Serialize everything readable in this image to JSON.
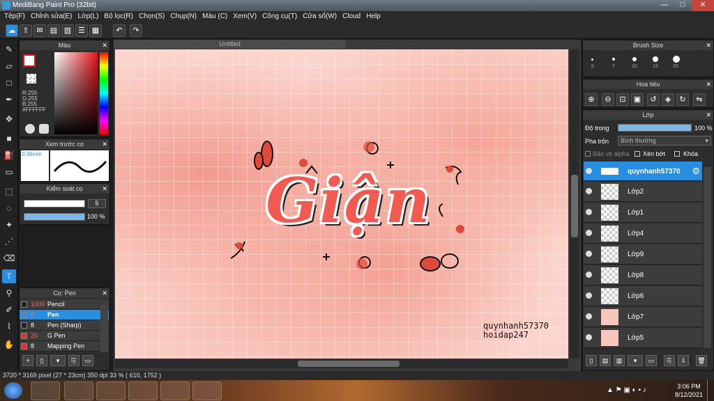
{
  "window": {
    "title": "MediBang Paint Pro (32bit)"
  },
  "menu": [
    "Tệp(F)",
    "Chỉnh sửa(E)",
    "Lớp(L)",
    "Bộ lọc(R)",
    "Chọn(S)",
    "Chụp(N)",
    "Màu (C)",
    "Xem(V)",
    "Công cụ(T)",
    "Cửa sổ(W)",
    "Cloud",
    "Help"
  ],
  "color_panel": {
    "title": "Màu",
    "r": "R:255",
    "g": "G:255",
    "b": "B:255",
    "hex": "#FFFFFF",
    "primary_color": "#e8141b"
  },
  "preview_panel": {
    "title": "Xem trước cọ",
    "size": "0.36mm"
  },
  "brush_control": {
    "title": "Kiểm soát cọ",
    "size_value": "5",
    "opacity_value": "100 %"
  },
  "brush_list": {
    "title": "Cọ: Pen",
    "items": [
      {
        "size": "1000",
        "name": "Pencil",
        "color": "#222222",
        "selected": false
      },
      {
        "size": "5",
        "name": "Pen",
        "color": "#2a8ee0",
        "selected": true
      },
      {
        "size": "8",
        "name": "Pen (Sharp)",
        "color": "#222222",
        "selected": false
      },
      {
        "size": "20",
        "name": "G Pen",
        "color": "#e03030",
        "selected": false
      },
      {
        "size": "8",
        "name": "Mapping Pen",
        "color": "#e03030",
        "selected": false
      }
    ]
  },
  "document": {
    "tab": "Untitled",
    "artwork_word": "Giận",
    "credit_line1": "quynhanh57370",
    "credit_line2": "hoidap247"
  },
  "brush_size_panel": {
    "title": "Brush Size",
    "sizes": [
      "5",
      "7",
      "10",
      "15",
      "20"
    ]
  },
  "navigator_panel": {
    "title": "Hoa tiêu"
  },
  "layer_panel": {
    "title": "Lớp",
    "opacity_label": "Độ trong",
    "opacity_value": "100 %",
    "blend_label": "Pha trộn",
    "blend_value": "Bình thường",
    "protect_alpha": "Bảo vệ alpha",
    "clipping": "Xén bớt",
    "lock": "Khóa",
    "layers": [
      "quynhanh57370",
      "Lớp2",
      "Lớp1",
      "Lớp4",
      "Lớp9",
      "Lớp8",
      "Lớp6",
      "Lớp7",
      "Lớp5"
    ]
  },
  "status": {
    "text": "3720 * 3169 pixel   (27 * 23cm)   350 dpi   33 %   ( 610, 1752 )"
  },
  "taskbar": {
    "time": "3:06 PM",
    "date": "8/12/2021"
  }
}
